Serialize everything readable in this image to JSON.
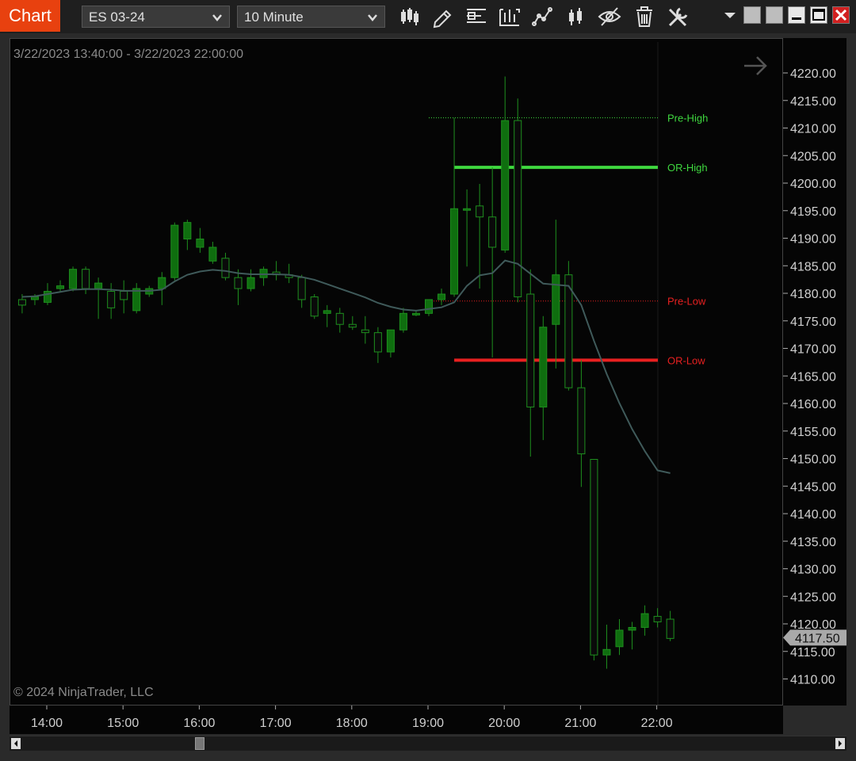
{
  "toolbar": {
    "chart_tab": "Chart",
    "instrument": "ES 03-24",
    "interval": "10 Minute",
    "icons": [
      "bar-type-icon",
      "drawing-tools-icon",
      "data-box-icon",
      "indicators-icon",
      "strategies-icon",
      "templates-icon",
      "visibility-icon",
      "delete-icon",
      "properties-icon"
    ]
  },
  "chart": {
    "date_range": "3/22/2023 13:40:00 - 3/22/2023 22:00:00",
    "copyright": "© 2024 NinjaTrader, LLC",
    "current_price": "4117.50"
  },
  "chart_data": {
    "type": "candlestick",
    "price_ticks": [
      "4220.00",
      "4215.00",
      "4210.00",
      "4205.00",
      "4200.00",
      "4195.00",
      "4190.00",
      "4185.00",
      "4180.00",
      "4175.00",
      "4170.00",
      "4165.00",
      "4160.00",
      "4155.00",
      "4150.00",
      "4145.00",
      "4140.00",
      "4135.00",
      "4130.00",
      "4125.00",
      "4120.00",
      "4115.00",
      "4110.00"
    ],
    "time_ticks": [
      "14:00",
      "15:00",
      "16:00",
      "17:00",
      "18:00",
      "19:00",
      "20:00",
      "21:00",
      "22:00"
    ],
    "ylim": [
      4107.5,
      4225.0
    ],
    "levels": [
      {
        "label": "Pre-High",
        "value": 4212.0,
        "color": "#3fd83f",
        "style": "dotted",
        "start": "19:00"
      },
      {
        "label": "OR-High",
        "value": 4203.0,
        "color": "#3fd83f",
        "style": "solid",
        "start": "19:20"
      },
      {
        "label": "Pre-Low",
        "value": 4178.75,
        "color": "#e82020",
        "style": "dotted",
        "start": "19:00"
      },
      {
        "label": "OR-Low",
        "value": 4168.0,
        "color": "#e82020",
        "style": "solid",
        "start": "19:20"
      }
    ],
    "candles": [
      {
        "t": "13:40",
        "o": 4179,
        "h": 4180,
        "l": 4176.5,
        "c": 4178
      },
      {
        "t": "13:50",
        "o": 4179,
        "h": 4180,
        "l": 4178,
        "c": 4179.5
      },
      {
        "t": "14:00",
        "o": 4178.5,
        "h": 4182,
        "l": 4178,
        "c": 4180.5
      },
      {
        "t": "14:10",
        "o": 4181,
        "h": 4182.5,
        "l": 4180.5,
        "c": 4181.5
      },
      {
        "t": "14:20",
        "o": 4181,
        "h": 4185,
        "l": 4180.5,
        "c": 4184.5
      },
      {
        "t": "14:30",
        "o": 4184.5,
        "h": 4185,
        "l": 4180,
        "c": 4181
      },
      {
        "t": "14:40",
        "o": 4181,
        "h": 4183,
        "l": 4175.5,
        "c": 4182
      },
      {
        "t": "14:50",
        "o": 4180.5,
        "h": 4182,
        "l": 4175.5,
        "c": 4177.5
      },
      {
        "t": "15:00",
        "o": 4180.5,
        "h": 4182.5,
        "l": 4176.5,
        "c": 4179
      },
      {
        "t": "15:10",
        "o": 4177,
        "h": 4182,
        "l": 4176.5,
        "c": 4181
      },
      {
        "t": "15:20",
        "o": 4180,
        "h": 4181.5,
        "l": 4179.5,
        "c": 4181
      },
      {
        "t": "15:30",
        "o": 4181,
        "h": 4184,
        "l": 4178,
        "c": 4183
      },
      {
        "t": "15:40",
        "o": 4183,
        "h": 4193,
        "l": 4182.5,
        "c": 4192.5
      },
      {
        "t": "15:50",
        "o": 4190,
        "h": 4193.5,
        "l": 4188,
        "c": 4193
      },
      {
        "t": "16:00",
        "o": 4188.5,
        "h": 4192,
        "l": 4187.5,
        "c": 4190
      },
      {
        "t": "16:10",
        "o": 4186,
        "h": 4189.5,
        "l": 4185.5,
        "c": 4188.5
      },
      {
        "t": "16:20",
        "o": 4186.5,
        "h": 4187.5,
        "l": 4182.5,
        "c": 4183
      },
      {
        "t": "16:30",
        "o": 4183,
        "h": 4184.5,
        "l": 4178,
        "c": 4181
      },
      {
        "t": "16:40",
        "o": 4181,
        "h": 4184.5,
        "l": 4180.5,
        "c": 4183
      },
      {
        "t": "16:50",
        "o": 4183,
        "h": 4185,
        "l": 4181.5,
        "c": 4184.5
      },
      {
        "t": "17:00",
        "o": 4184,
        "h": 4186,
        "l": 4182.5,
        "c": 4183.5
      },
      {
        "t": "17:10",
        "o": 4183.5,
        "h": 4185.5,
        "l": 4182,
        "c": 4183
      },
      {
        "t": "17:20",
        "o": 4183,
        "h": 4183.5,
        "l": 4177.5,
        "c": 4179
      },
      {
        "t": "17:30",
        "o": 4179.5,
        "h": 4180,
        "l": 4175.5,
        "c": 4176
      },
      {
        "t": "17:40",
        "o": 4176.5,
        "h": 4178,
        "l": 4174,
        "c": 4177
      },
      {
        "t": "17:50",
        "o": 4176.5,
        "h": 4177.5,
        "l": 4173,
        "c": 4174.5
      },
      {
        "t": "18:00",
        "o": 4174.5,
        "h": 4176,
        "l": 4173.5,
        "c": 4174
      },
      {
        "t": "18:10",
        "o": 4173.5,
        "h": 4176,
        "l": 4171,
        "c": 4173
      },
      {
        "t": "18:20",
        "o": 4173,
        "h": 4174,
        "l": 4167.5,
        "c": 4169.5
      },
      {
        "t": "18:30",
        "o": 4169.5,
        "h": 4173.5,
        "l": 4168.5,
        "c": 4173.5
      },
      {
        "t": "18:40",
        "o": 4173.5,
        "h": 4177.5,
        "l": 4173,
        "c": 4176.5
      },
      {
        "t": "18:50",
        "o": 4176.5,
        "h": 4177,
        "l": 4176,
        "c": 4176.5
      },
      {
        "t": "19:00",
        "o": 4176.5,
        "h": 4179,
        "l": 4176,
        "c": 4179
      },
      {
        "t": "19:10",
        "o": 4179,
        "h": 4181,
        "l": 4178,
        "c": 4180
      },
      {
        "t": "19:20",
        "o": 4180,
        "h": 4212,
        "l": 4179.5,
        "c": 4195.5
      },
      {
        "t": "19:30",
        "o": 4195.5,
        "h": 4199,
        "l": 4185,
        "c": 4195.5
      },
      {
        "t": "19:40",
        "o": 4196,
        "h": 4200,
        "l": 4181,
        "c": 4194
      },
      {
        "t": "19:50",
        "o": 4194,
        "h": 4203,
        "l": 4168.5,
        "c": 4188.5
      },
      {
        "t": "20:00",
        "o": 4188,
        "h": 4219.5,
        "l": 4187.5,
        "c": 4211.5
      },
      {
        "t": "20:10",
        "o": 4211.5,
        "h": 4215.5,
        "l": 4178.5,
        "c": 4179.5
      },
      {
        "t": "20:20",
        "o": 4180,
        "h": 4184.5,
        "l": 4150.5,
        "c": 4159.5
      },
      {
        "t": "20:30",
        "o": 4159.5,
        "h": 4176,
        "l": 4153.5,
        "c": 4174
      },
      {
        "t": "20:40",
        "o": 4174.5,
        "h": 4193.5,
        "l": 4166.5,
        "c": 4183.5
      },
      {
        "t": "20:50",
        "o": 4183.5,
        "h": 4186,
        "l": 4162.5,
        "c": 4163
      },
      {
        "t": "21:00",
        "o": 4163,
        "h": 4168,
        "l": 4145,
        "c": 4151
      },
      {
        "t": "21:10",
        "o": 4150,
        "h": 4150,
        "l": 4113.5,
        "c": 4114.5
      },
      {
        "t": "21:20",
        "o": 4114.5,
        "h": 4120,
        "l": 4112,
        "c": 4115.5
      },
      {
        "t": "21:30",
        "o": 4116,
        "h": 4121,
        "l": 4114.5,
        "c": 4119
      },
      {
        "t": "21:40",
        "o": 4119,
        "h": 4120.5,
        "l": 4115.5,
        "c": 4119.5
      },
      {
        "t": "21:50",
        "o": 4119.5,
        "h": 4123.5,
        "l": 4118,
        "c": 4122
      },
      {
        "t": "22:00",
        "o": 4121.5,
        "h": 4123,
        "l": 4119.5,
        "c": 4120.5
      },
      {
        "t": "22:10",
        "o": 4121,
        "h": 4122.5,
        "l": 4117,
        "c": 4117.5
      }
    ],
    "ma": [
      4179.5,
      4179.6,
      4180,
      4180.4,
      4180.8,
      4180.9,
      4180.9,
      4180.8,
      4180.6,
      4180.6,
      4180.6,
      4180.8,
      4182.3,
      4183.5,
      4184.1,
      4184.4,
      4184.2,
      4183.8,
      4183.6,
      4183.6,
      4183.6,
      4183.5,
      4183.1,
      4182.6,
      4181.8,
      4181,
      4180.2,
      4179.4,
      4178.4,
      4177.7,
      4177.2,
      4177,
      4177.3,
      4177.6,
      4178.5,
      4181.5,
      4183.4,
      4183.8,
      4186.1,
      4185.5,
      4183.7,
      4181.9,
      4181.7,
      4181.5,
      4178,
      4171.5,
      4165.5,
      4160.2,
      4155.5,
      4151.5,
      4148,
      4147.5
    ],
    "candle_colors": {
      "up": "#0f6e0f",
      "down": "#0a0a0a",
      "outline": "#1e8f1e"
    },
    "ma_color": "#3f5a5a"
  }
}
